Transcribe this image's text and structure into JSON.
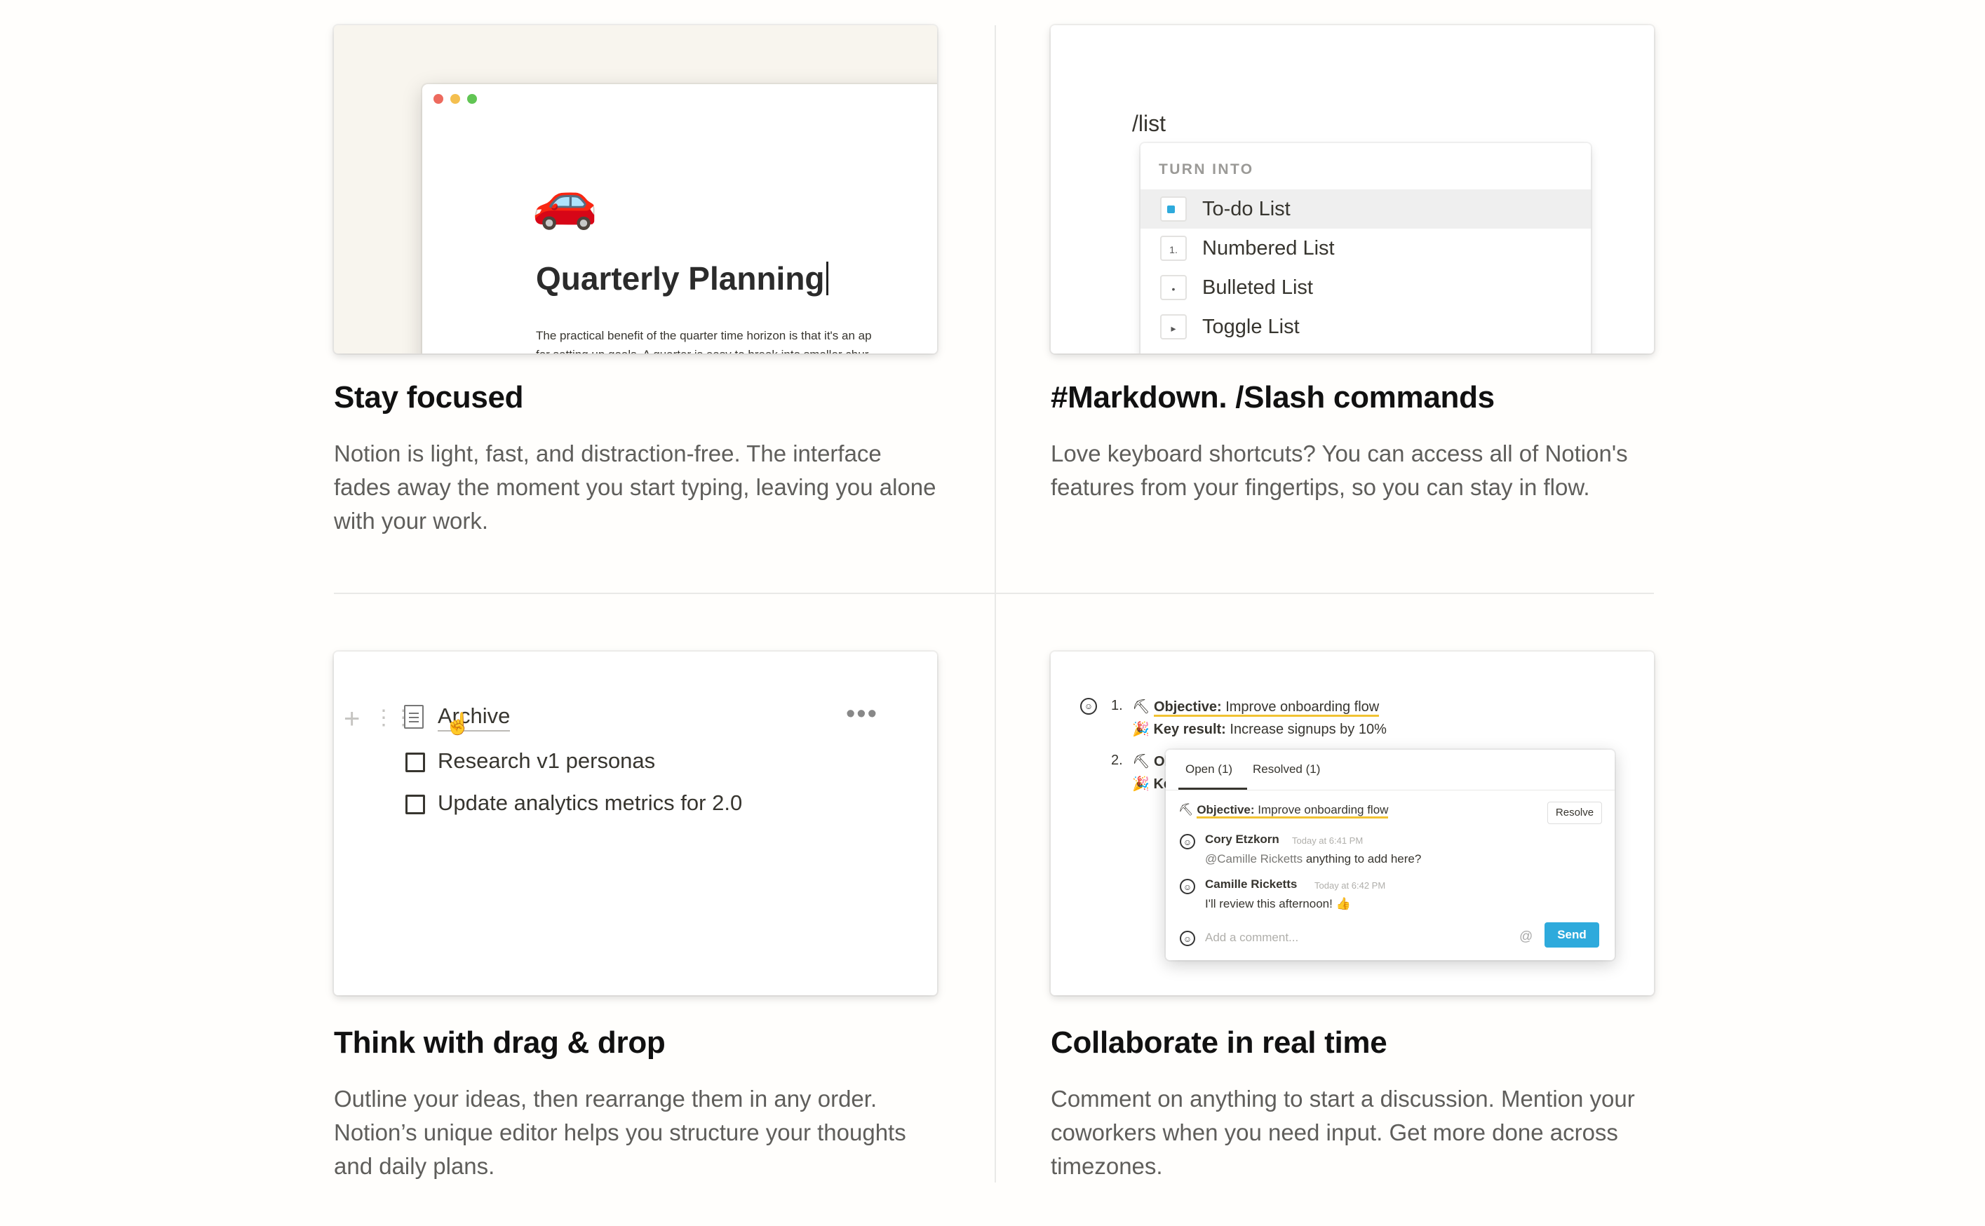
{
  "features": [
    {
      "title": "Stay focused",
      "description": "Notion is light, fast, and distraction-free. The interface fades away the moment you start typing, leaving you alone with your work.",
      "mock": {
        "emoji": "🚗",
        "page_title": "Quarterly Planning",
        "body_line1": "The practical benefit of the quarter time horizon is that it's an ap",
        "body_line2": "for setting up goals. A quarter is easy to break into smaller chur",
        "window_dots": [
          "#ed6a5e",
          "#f4bf4f",
          "#61c554"
        ]
      }
    },
    {
      "title": "#Markdown. /Slash commands",
      "description": "Love keyboard shortcuts? You can access all of Notion's features from your fingertips, so you can stay in flow.",
      "mock": {
        "command": "/list",
        "menu_header": "TURN INTO",
        "menu_items": [
          {
            "label": "To-do List",
            "icon": "checkbox-icon",
            "glyph": ""
          },
          {
            "label": "Numbered List",
            "icon": "numbered-list-icon",
            "glyph": "1."
          },
          {
            "label": "Bulleted List",
            "icon": "bulleted-list-icon",
            "glyph": "•"
          },
          {
            "label": "Toggle List",
            "icon": "toggle-list-icon",
            "glyph": "▸"
          }
        ]
      }
    },
    {
      "title": "Think with drag & drop",
      "description": "Outline your ideas, then rearrange them in any order. Notion’s unique editor helps you structure your thoughts and daily plans.",
      "mock": {
        "page_label": "Archive",
        "more_glyph": "•••",
        "plus_glyph": "+",
        "grip_glyph": "⋮⋮",
        "todos": [
          "Research v1 personas",
          "Update analytics metrics for 2.0"
        ]
      }
    },
    {
      "title": "Collaborate in real time",
      "description": "Comment on anything to start a discussion. Mention your coworkers when you need input. Get more done across timezones.",
      "mock": {
        "item1_number": "1.",
        "item1_objective_label": "Objective:",
        "item1_objective_text": "Improve onboarding flow",
        "item1_kr_label": "Key result:",
        "item1_kr_text": "Increase signups by 10%",
        "item2_number": "2.",
        "item2_objective_label": "Ol",
        "item2_kr_label": "Ke",
        "tab_open": "Open (1)",
        "tab_resolved": "Resolved (1)",
        "popup_objective_label": "Objective:",
        "popup_objective_text": "Improve onboarding flow",
        "resolve_label": "Resolve",
        "comments": [
          {
            "name": "Cory Etzkorn",
            "time": "Today at 6:41 PM",
            "mention": "@Camille Ricketts",
            "text": " anything to add here?"
          },
          {
            "name": "Camille Ricketts",
            "time": "Today at 6:42 PM",
            "mention": "",
            "text": "I'll review this afternoon! 👍"
          }
        ],
        "comment_placeholder": "Add a comment...",
        "at_glyph": "@",
        "send_label": "Send",
        "accent_color": "#2eaadc"
      }
    }
  ]
}
